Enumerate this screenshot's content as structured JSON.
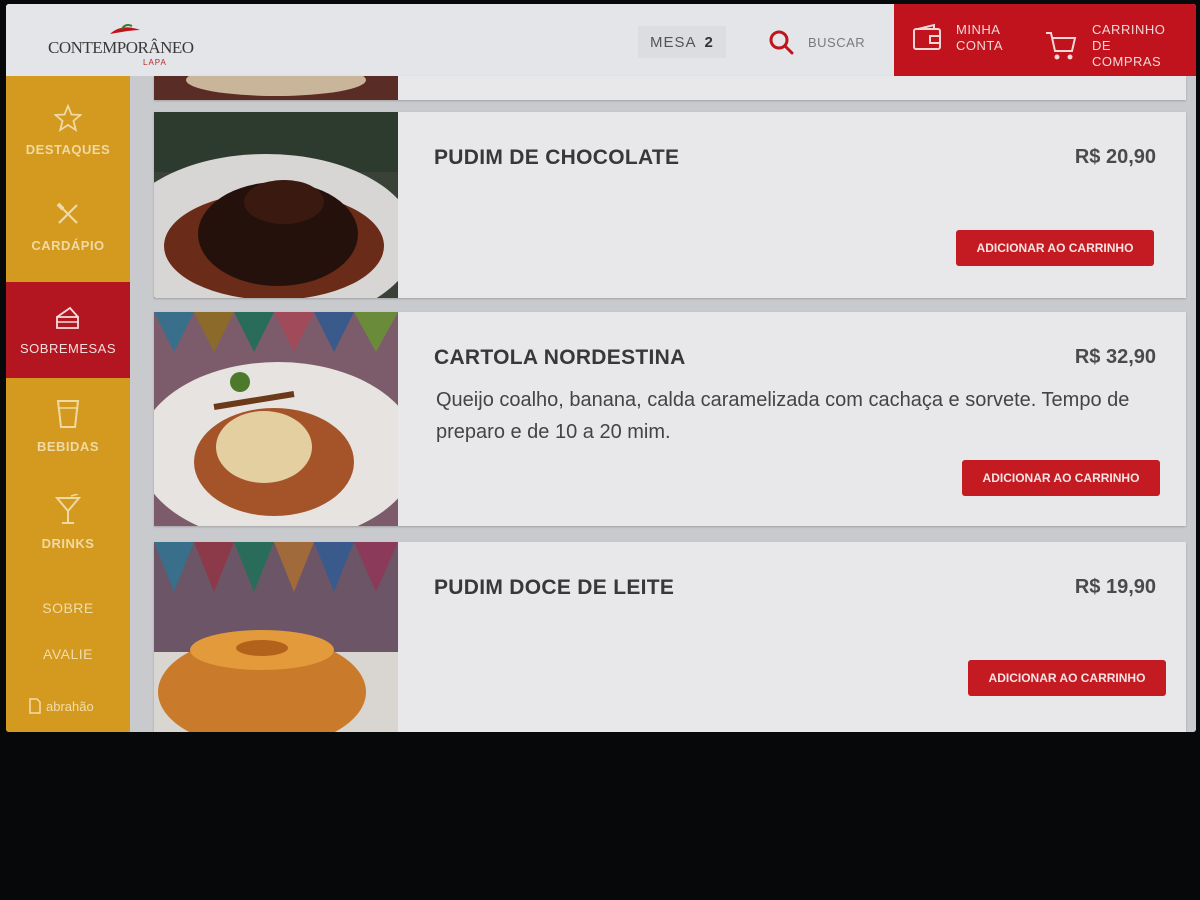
{
  "header": {
    "logo_text": "CONTEMPORÂNEO",
    "logo_sub": "LAPA",
    "mesa_label": "MESA",
    "mesa_number": "2",
    "search_label": "BUSCAR",
    "account_label": "MINHA CONTA",
    "cart_label": "CARRINHO DE COMPRAS",
    "accent_color": "#c0131d"
  },
  "sidebar": {
    "items": [
      {
        "label": "DESTAQUES",
        "icon": "star-icon",
        "active": false
      },
      {
        "label": "CARDÁPIO",
        "icon": "fork-knife-icon",
        "active": false
      },
      {
        "label": "SOBREMESAS",
        "icon": "cake-slice-icon",
        "active": true
      },
      {
        "label": "BEBIDAS",
        "icon": "glass-icon",
        "active": false
      },
      {
        "label": "DRINKS",
        "icon": "cocktail-icon",
        "active": false
      }
    ],
    "links": [
      "SOBRE",
      "AVALIE"
    ],
    "brand": "abrahão",
    "color": "#d49a1f"
  },
  "products": [
    {
      "name": "PUDIM  DE CHOCOLATE",
      "price": "R$ 20,90",
      "description": "",
      "button": "ADICIONAR AO CARRINHO"
    },
    {
      "name": "CARTOLA NORDESTINA",
      "price": "R$ 32,90",
      "description": "Queijo coalho, banana, calda caramelizada com cachaça e sorvete. Tempo de preparo e de 10 a 20 mim.",
      "button": "ADICIONAR AO CARRINHO"
    },
    {
      "name": "PUDIM  DOCE DE LEITE",
      "price": "R$ 19,90",
      "description": "",
      "button": "ADICIONAR AO CARRINHO"
    }
  ]
}
